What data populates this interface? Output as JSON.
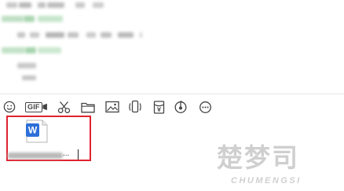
{
  "toolbar": {
    "items": [
      {
        "name": "emoji-icon"
      },
      {
        "name": "gif-icon",
        "label": "GIF"
      },
      {
        "name": "scissors-icon"
      },
      {
        "name": "folder-icon"
      },
      {
        "name": "image-icon"
      },
      {
        "name": "phone-shake-icon"
      },
      {
        "name": "red-envelope-icon"
      },
      {
        "name": "voice-icon"
      },
      {
        "name": "more-icon"
      }
    ]
  },
  "attachment": {
    "icon_letter": "W",
    "ellipsis": "...",
    "highlight_color": "#e0232f"
  },
  "watermark": {
    "cjk_text": "楚梦司",
    "latin_text": "CHUMENGSI"
  }
}
